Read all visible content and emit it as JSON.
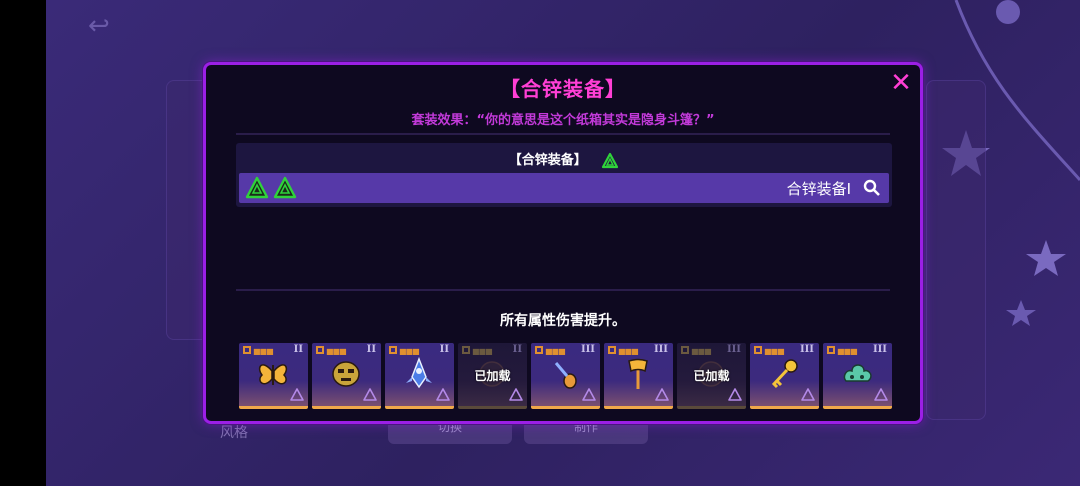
{
  "background": {
    "style_label": "风格",
    "bottom_buttons": [
      "切换",
      "制作"
    ]
  },
  "dialog": {
    "title": "【合锌装备】",
    "effect_text": "套装效果：“你的意思是这个纸箱其实是隐身斗篷？”",
    "set_header": "【合锌装备】",
    "set_row_name": "合锌装备I",
    "bonus_text": "所有属性伤害提升。",
    "loaded_label": "已加载",
    "close_icon": "close-icon",
    "search_icon": "search-icon",
    "colors": {
      "accent": "#9b1fe6",
      "title": "#ff3fd5",
      "effect": "#c23ad9",
      "set_icon": "#2fd33a",
      "row": "#5639a8"
    },
    "items": [
      {
        "name": "butterfly-icon",
        "tier": "II",
        "loaded": false,
        "loaded_label": ""
      },
      {
        "name": "mask-icon",
        "tier": "II",
        "loaded": false,
        "loaded_label": ""
      },
      {
        "name": "spaceship-icon",
        "tier": "II",
        "loaded": false,
        "loaded_label": ""
      },
      {
        "name": "loaded-item-icon",
        "tier": "II",
        "loaded": true,
        "loaded_label": "已加载"
      },
      {
        "name": "spoon-icon",
        "tier": "III",
        "loaded": false,
        "loaded_label": ""
      },
      {
        "name": "axe-icon",
        "tier": "III",
        "loaded": false,
        "loaded_label": ""
      },
      {
        "name": "loaded-item-icon",
        "tier": "III",
        "loaded": true,
        "loaded_label": "已加载"
      },
      {
        "name": "key-icon",
        "tier": "III",
        "loaded": false,
        "loaded_label": ""
      },
      {
        "name": "cloud-icon",
        "tier": "III",
        "loaded": false,
        "loaded_label": ""
      }
    ]
  }
}
